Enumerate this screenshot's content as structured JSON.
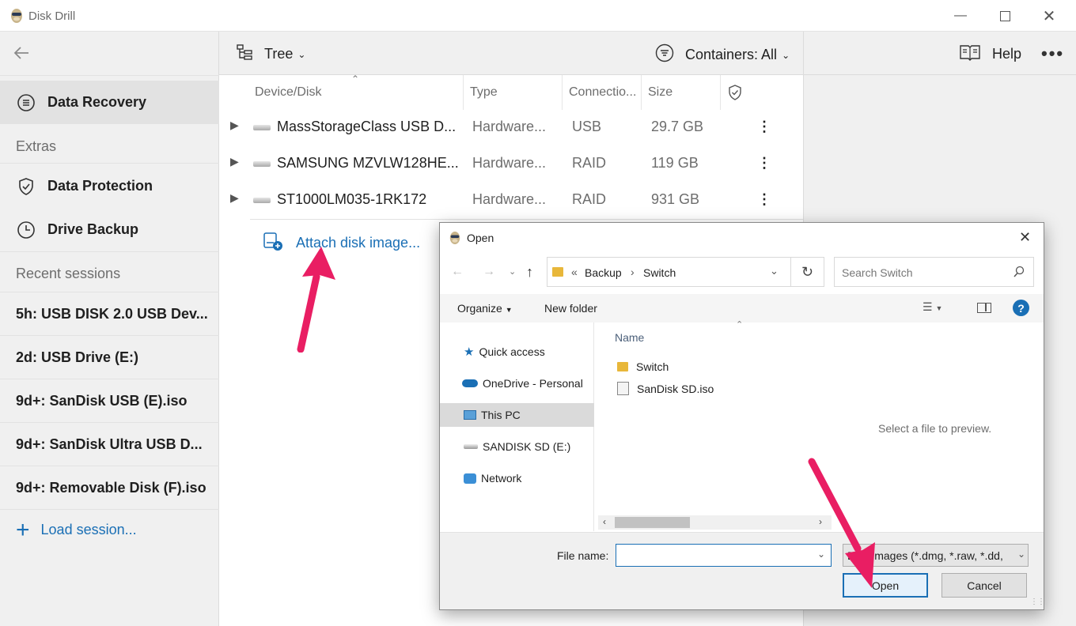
{
  "window": {
    "title": "Disk Drill"
  },
  "sidebar": {
    "items": [
      {
        "label": "Data Recovery",
        "icon": "recovery-icon"
      },
      {
        "label": "Data Protection",
        "icon": "shield-icon"
      },
      {
        "label": "Drive Backup",
        "icon": "backup-icon"
      }
    ],
    "extras_label": "Extras",
    "recent_label": "Recent sessions",
    "sessions": [
      "5h: USB DISK 2.0 USB Dev...",
      "2d: USB Drive (E:)",
      "9d+: SanDisk USB (E).iso",
      "9d+: SanDisk Ultra USB D...",
      "9d+: Removable Disk (F).iso"
    ],
    "load_session": "Load session..."
  },
  "toolbar": {
    "view_label": "Tree",
    "containers_label": "Containers: All",
    "help_label": "Help"
  },
  "table": {
    "headers": [
      "Device/Disk",
      "Type",
      "Connectio...",
      "Size"
    ],
    "rows": [
      {
        "name": "MassStorageClass USB D...",
        "type": "Hardware...",
        "connection": "USB",
        "size": "29.7 GB"
      },
      {
        "name": "SAMSUNG MZVLW128HE...",
        "type": "Hardware...",
        "connection": "RAID",
        "size": "119 GB"
      },
      {
        "name": "ST1000LM035-1RK172",
        "type": "Hardware...",
        "connection": "RAID",
        "size": "931 GB"
      }
    ],
    "attach_label": "Attach disk image..."
  },
  "dialog": {
    "title": "Open",
    "breadcrumb": {
      "prefix": "«",
      "parts": [
        "Backup",
        "Switch"
      ]
    },
    "search_placeholder": "Search Switch",
    "organize_label": "Organize",
    "new_folder_label": "New folder",
    "nav": [
      "Quick access",
      "OneDrive - Personal",
      "This PC",
      "SANDISK SD (E:)",
      "Network"
    ],
    "column_name": "Name",
    "files": [
      {
        "name": "Switch",
        "icon": "folder-icon"
      },
      {
        "name": "SanDisk SD.iso",
        "icon": "disc-image-icon"
      }
    ],
    "preview_text": "Select a file to preview.",
    "file_name_label": "File name:",
    "file_name_value": "",
    "filter_value": "Disk images (*.dmg, *.raw, *.dd,",
    "open_label": "Open",
    "cancel_label": "Cancel"
  },
  "colors": {
    "accent": "#1a6fb5",
    "arrow": "#e91e63",
    "selection": "#dadada"
  }
}
